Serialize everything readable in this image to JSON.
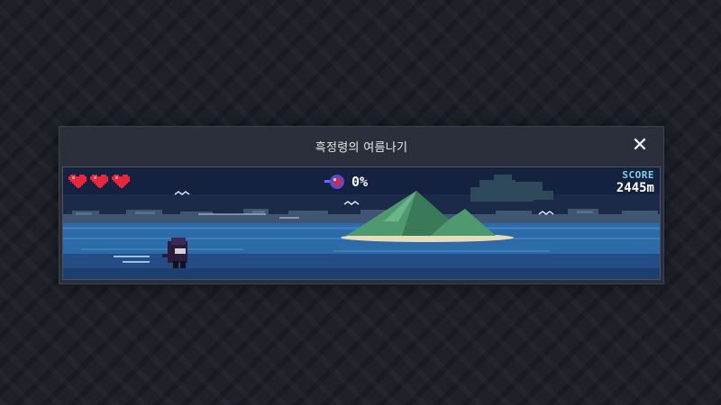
{
  "window": {
    "title": "흑정령의 여름나기",
    "close_label": "✕"
  },
  "hud": {
    "lives": {
      "current": 3,
      "max": 3,
      "icon": "heart-icon",
      "color": "#e8283a"
    },
    "progress": {
      "icon": "orb-icon",
      "text": "0%",
      "value": 0
    },
    "score": {
      "label": "SCORE",
      "value": "2445m"
    }
  },
  "colors": {
    "sky": "#15223f",
    "sea": "#2d6aa8",
    "island": "#4e9a6e",
    "score_label": "#7fd0ec"
  }
}
